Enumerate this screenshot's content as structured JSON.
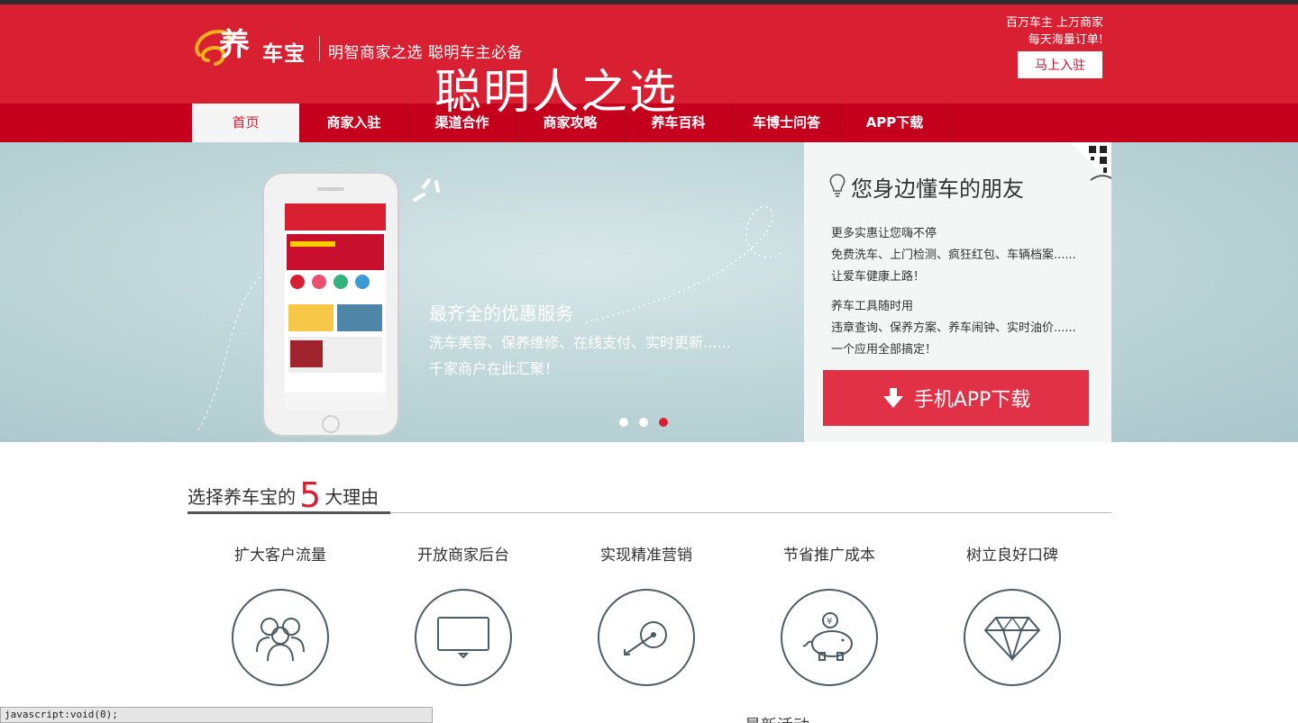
{
  "header": {
    "logo_text": "车宝",
    "slogan": "明智商家之选  聪明车主必备",
    "promo_line1": "百万车主 上万商家",
    "promo_line2": "每天海量订单!",
    "join_button": "马上入驻",
    "accent_color": "#d91f32"
  },
  "nav": {
    "items": [
      {
        "label": "首页"
      },
      {
        "label": "商家入驻"
      },
      {
        "label": "渠道合作"
      },
      {
        "label": "商家攻略"
      },
      {
        "label": "养车百科"
      },
      {
        "label": "车博士问答"
      },
      {
        "label": "APP下载"
      }
    ]
  },
  "banner": {
    "title": "聪明人之选",
    "subtitle": "最齐全的优惠服务",
    "line1": "洗车美容、保养维修、在线支付、实时更新......",
    "line2": "千家商户在此汇聚！",
    "active_slide": 3
  },
  "panel": {
    "title": "您身边懂车的朋友",
    "block1_title": "更多实惠让您嗨不停",
    "block1_line1": "免费洗车、上门检测、疯狂红包、车辆档案......",
    "block1_line2": "让爱车健康上路！",
    "block2_title": "养车工具随时用",
    "block2_line1": "违章查询、保养方案、养车闹钟、实时油价......",
    "block2_line2": "一个应用全部搞定！",
    "download_button": "手机APP下载"
  },
  "reasons": {
    "title_before": "选择养车宝的",
    "title_number": "5",
    "title_after": "大理由",
    "items": [
      {
        "label": "扩大客户流量",
        "icon": "people-icon"
      },
      {
        "label": "开放商家后台",
        "icon": "monitor-icon"
      },
      {
        "label": "实现精准营销",
        "icon": "target-icon"
      },
      {
        "label": "节省推广成本",
        "icon": "piggy-bank-icon"
      },
      {
        "label": "树立良好口碑",
        "icon": "diamond-icon"
      }
    ]
  },
  "status_bar": "javascript:void(0);",
  "cut_heading": "最新活动"
}
